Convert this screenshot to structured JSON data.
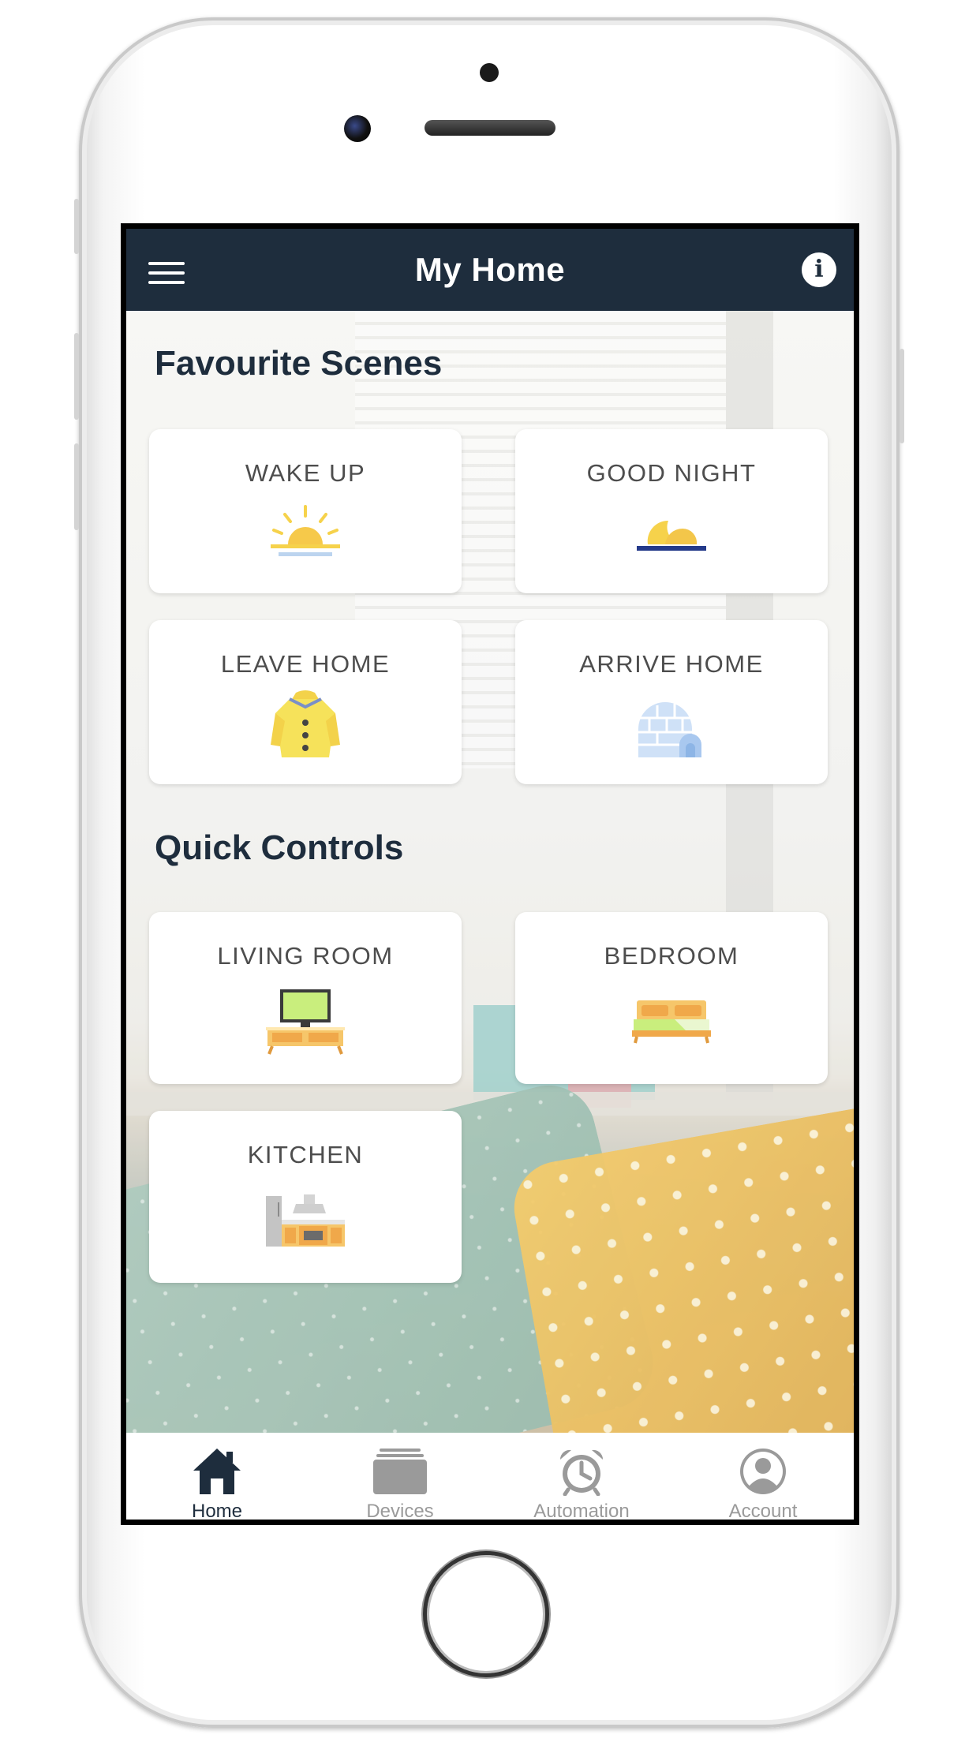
{
  "header": {
    "title": "My Home",
    "menu_icon": "hamburger-menu-icon",
    "info_icon": "info-icon",
    "info_glyph": "i"
  },
  "favourite_scenes": {
    "title": "Favourite Scenes",
    "items": [
      {
        "label": "WAKE UP",
        "icon": "sunrise-icon"
      },
      {
        "label": "GOOD NIGHT",
        "icon": "moon-icon"
      },
      {
        "label": "LEAVE HOME",
        "icon": "raincoat-icon"
      },
      {
        "label": "ARRIVE HOME",
        "icon": "igloo-icon"
      }
    ]
  },
  "quick_controls": {
    "title": "Quick Controls",
    "items": [
      {
        "label": "LIVING ROOM",
        "icon": "tv-stand-icon"
      },
      {
        "label": "BEDROOM",
        "icon": "bed-icon"
      },
      {
        "label": "KITCHEN",
        "icon": "kitchen-icon"
      }
    ]
  },
  "tabbar": {
    "active": "Home",
    "tabs": [
      {
        "label": "Home",
        "icon": "home-icon"
      },
      {
        "label": "Devices",
        "icon": "devices-icon"
      },
      {
        "label": "Automation",
        "icon": "alarm-clock-icon"
      },
      {
        "label": "Account",
        "icon": "account-icon"
      }
    ]
  },
  "colors": {
    "header_bg": "#1e2d3d",
    "active_tab": "#1e2d3d",
    "inactive_tab": "#9a9a9a",
    "card_label": "#4d4d4d"
  }
}
